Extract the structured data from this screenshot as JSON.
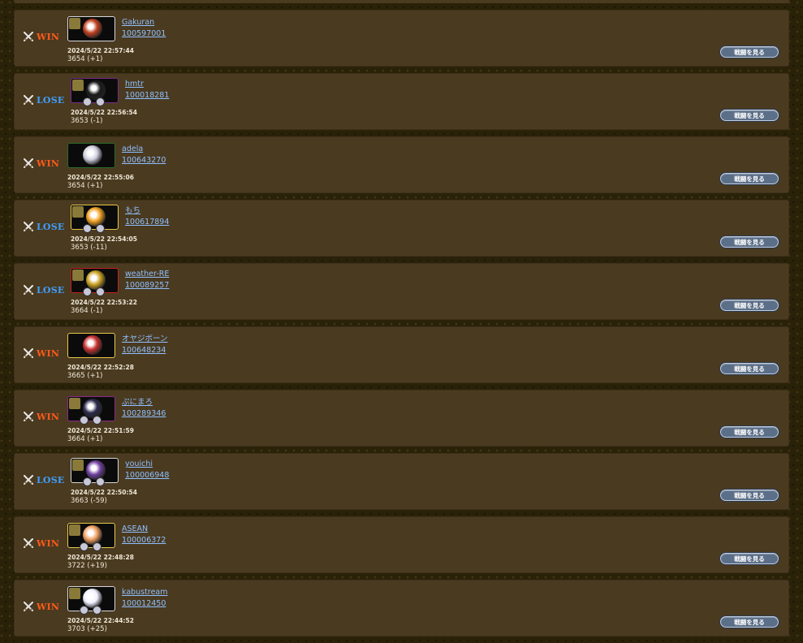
{
  "watch_label": "戦闘を見る",
  "colors": {
    "win": "#ff5a1a",
    "lose": "#3fa0ff",
    "link": "#8fc0ff",
    "panel": "#4a3a20"
  },
  "matches": [
    {
      "result": "WIN",
      "name": "Gakuran",
      "id": "100597001",
      "date": "2024/5/22 22:57:44",
      "rating": "3654 (+1)",
      "icon": "player-avatar-icon"
    },
    {
      "result": "LOSE",
      "name": "hmtr",
      "id": "100018281",
      "date": "2024/5/22 22:56:54",
      "rating": "3653 (-1)",
      "icon": "player-avatar-icon"
    },
    {
      "result": "WIN",
      "name": "adela",
      "id": "100643270",
      "date": "2024/5/22 22:55:06",
      "rating": "3654 (+1)",
      "icon": "player-avatar-icon"
    },
    {
      "result": "LOSE",
      "name": "もち",
      "id": "100617894",
      "date": "2024/5/22 22:54:05",
      "rating": "3653 (-11)",
      "icon": "player-avatar-icon"
    },
    {
      "result": "LOSE",
      "name": "weather-RE",
      "id": "100089257",
      "date": "2024/5/22 22:53:22",
      "rating": "3664 (-1)",
      "icon": "player-avatar-icon"
    },
    {
      "result": "WIN",
      "name": "オヤジボーン",
      "id": "100648234",
      "date": "2024/5/22 22:52:28",
      "rating": "3665 (+1)",
      "icon": "player-avatar-icon"
    },
    {
      "result": "WIN",
      "name": "ぷにまろ",
      "id": "100289346",
      "date": "2024/5/22 22:51:59",
      "rating": "3664 (+1)",
      "icon": "player-avatar-icon"
    },
    {
      "result": "LOSE",
      "name": "youichi",
      "id": "100006948",
      "date": "2024/5/22 22:50:54",
      "rating": "3663 (-59)",
      "icon": "player-avatar-icon"
    },
    {
      "result": "WIN",
      "name": "ASEAN",
      "id": "100006372",
      "date": "2024/5/22 22:48:28",
      "rating": "3722 (+19)",
      "icon": "player-avatar-icon"
    },
    {
      "result": "WIN",
      "name": "kabustream",
      "id": "100012450",
      "date": "2024/5/22 22:44:52",
      "rating": "3703 (+25)",
      "icon": "player-avatar-icon"
    }
  ]
}
